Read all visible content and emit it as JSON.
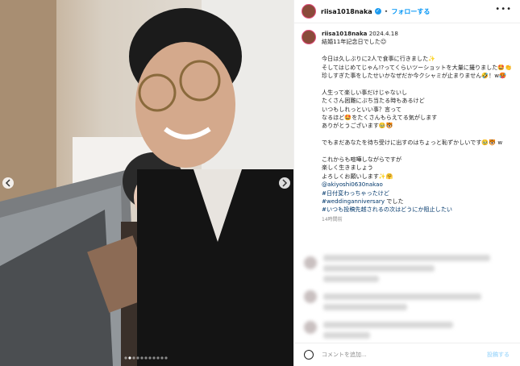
{
  "header": {
    "username": "riisa1018naka",
    "separator": "•",
    "follow_label": "フォローする",
    "more_label": "•••"
  },
  "caption": {
    "username": "riisa1018naka",
    "date": "2024.4.18",
    "lines": [
      "結婚11年記念日でした☺︎",
      "",
      "今日は久しぶりに2人で食事に行きました✨",
      "そしてはじめてじゃん!?ってくらいツーショットを大量に撮りました🤩👏",
      "珍しすぎた事をしたせいかなぜだか今クシャミが止まりません🤣！w🥵",
      "",
      "人生って楽しい事だけじゃないし",
      "たくさん困難にぶち当たる時もあるけど",
      "いつもしれっといい事？言って",
      "なるほど🤩をたくさんもらえてる気がします",
      "ありがとうございます🥹🐯",
      "",
      "でもまだあなたを待ち受けに出すのはちょっと恥ずかしいです🥹🐯 w",
      "",
      "これからも喧嘩しながらですが",
      "楽しく生きましょう",
      "よろしくお願いします✨🤗"
    ],
    "mention": "@akiyoshi0630nakao",
    "hashtags": [
      "#日付変わっちゃったけど",
      "#weddinganniversary",
      "#いつも投稿先越されるの次はどうにか阻止したい"
    ],
    "hashtag_suffix": "でした",
    "time_ago": "14時間前"
  },
  "comment_bar": {
    "placeholder": "コメントを追加...",
    "post_label": "投稿する"
  },
  "colors": {
    "accent": "#0095f6",
    "verified": "#1d9bf0"
  }
}
